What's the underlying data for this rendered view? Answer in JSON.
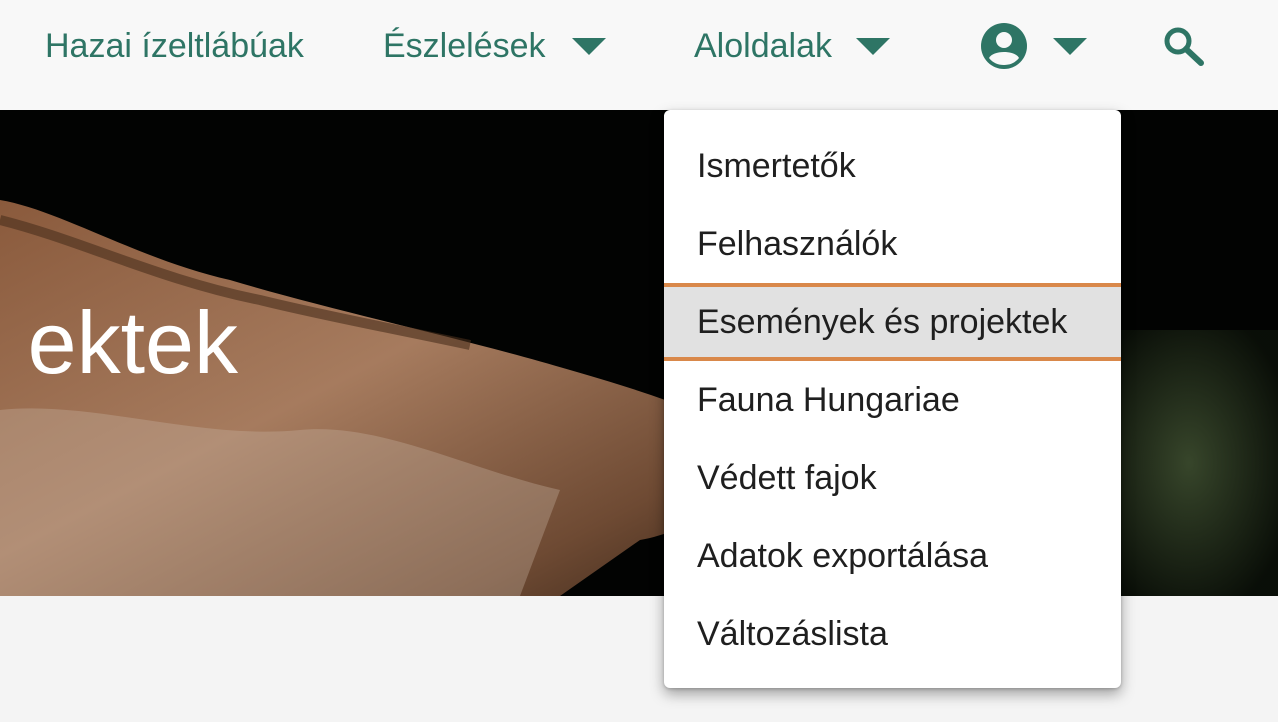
{
  "nav": {
    "home_label": "Hazai ízeltlábúak",
    "observations_label": "Észlelések",
    "subpages_label": "Aloldalak",
    "account_icon": "account-circle-icon",
    "search_icon": "search-icon"
  },
  "hero": {
    "title_fragment": "ektek"
  },
  "subpages_menu": {
    "items": [
      {
        "label": "Ismertetők"
      },
      {
        "label": "Felhasználók"
      },
      {
        "label": "Események és projektek",
        "active": true
      },
      {
        "label": "Fauna Hungariae"
      },
      {
        "label": "Védett fajok"
      },
      {
        "label": "Adatok exportálása"
      },
      {
        "label": "Változáslista"
      }
    ]
  },
  "colors": {
    "nav_text": "#2e7565",
    "active_border": "#d9884a",
    "active_background": "#e1e1e1",
    "hero_background": "#020302"
  }
}
